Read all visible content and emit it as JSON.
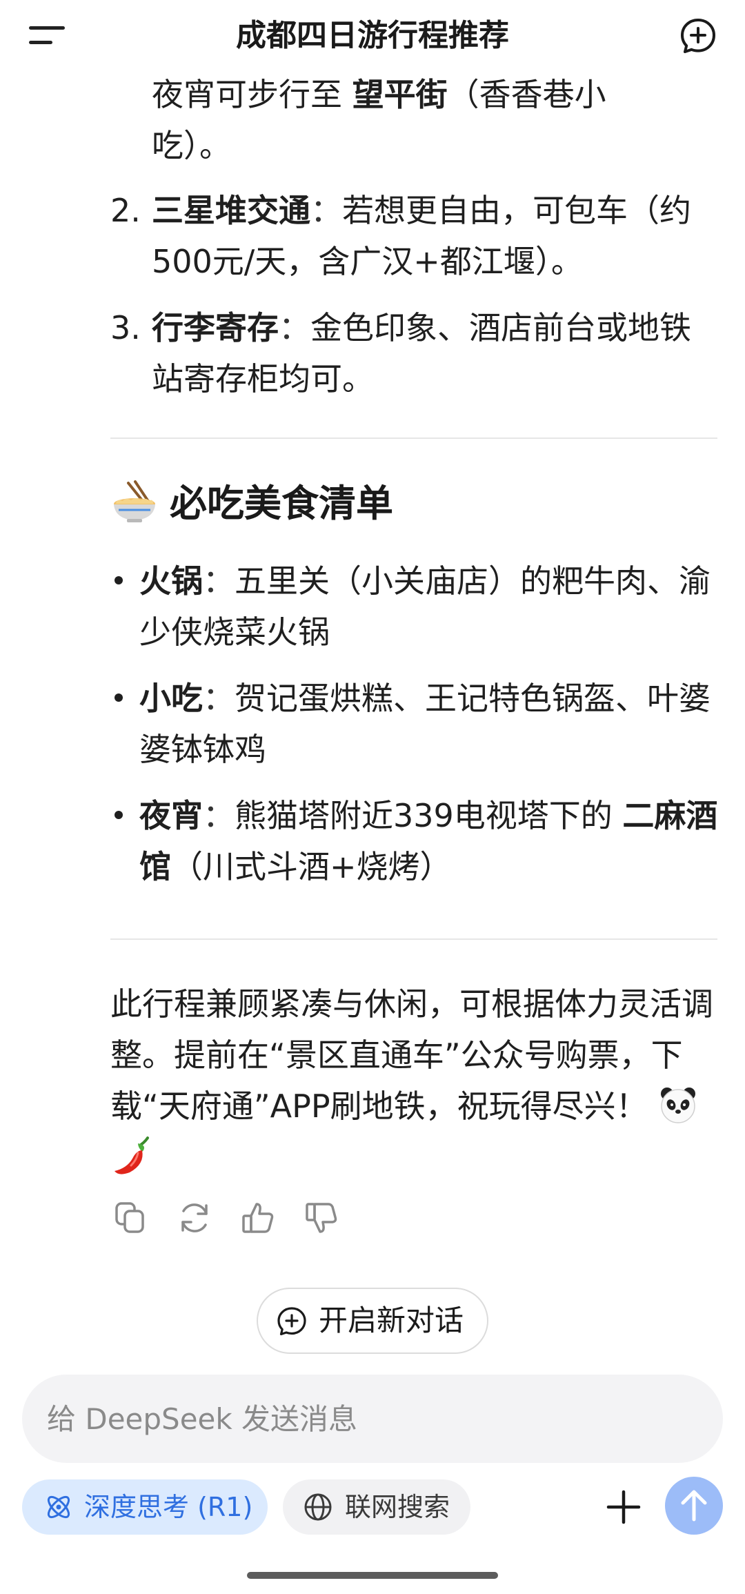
{
  "header": {
    "title": "成都四日游行程推荐",
    "menu_icon": "menu-icon",
    "new_chat_icon": "new-chat-icon"
  },
  "intro": {
    "prefix": "夜宵可步行至 ",
    "bold": "望平街",
    "suffix": "（香香巷小",
    "line2": "吃）。"
  },
  "ordered_list": [
    {
      "num": "2.",
      "title": "三星堆交通",
      "sep": "：",
      "text": "若想更自由，可包车（约500元/天，含广汉+都江堰）。"
    },
    {
      "num": "3.",
      "title": "行李寄存",
      "sep": "：",
      "text": "金色印象、酒店前台或地铁站寄存柜均可。"
    }
  ],
  "food_section": {
    "emoji_icon": "noodle-bowl-icon",
    "title": "必吃美食清单",
    "items": [
      {
        "label": "火锅",
        "sep": "：",
        "text": "五里关（小关庙店）的粑牛肉、渝少侠烧菜火锅",
        "bold2": "",
        "text2": ""
      },
      {
        "label": "小吃",
        "sep": "：",
        "text": "贺记蛋烘糕、王记特色锅盔、叶婆婆钵钵鸡",
        "bold2": "",
        "text2": ""
      },
      {
        "label": "夜宵",
        "sep": "：",
        "text": "熊猫塔附近339电视塔下的 ",
        "bold2": "二麻酒馆",
        "text2": "（川式斗酒+烧烤）"
      }
    ]
  },
  "closing": {
    "text": "此行程兼顾紧凑与休闲，可根据体力灵活调整。提前在“景区直通车”公众号购票，下载“天府通”APP刷地铁，祝玩得尽兴！ ",
    "emojis": [
      "panda-icon",
      "chili-pepper-icon"
    ]
  },
  "message_actions": [
    "copy-icon",
    "regenerate-icon",
    "thumbs-up-icon",
    "thumbs-down-icon"
  ],
  "new_chat_button": {
    "label": "开启新对话"
  },
  "composer": {
    "placeholder": "给 DeepSeek 发送消息",
    "deep_think_label": "深度思考 (R1)",
    "web_search_label": "联网搜索",
    "accent_color": "#2f6fe0",
    "send_color": "#9cbcf8"
  }
}
